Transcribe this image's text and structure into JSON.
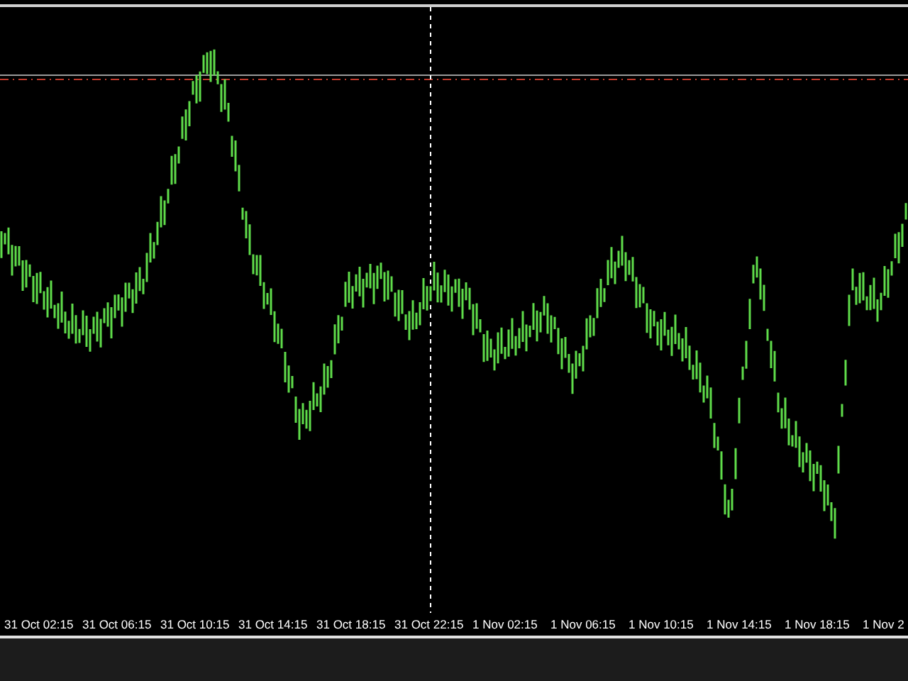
{
  "time_axis": {
    "labels": [
      "31 Oct 02:15",
      "31 Oct 06:15",
      "31 Oct 10:15",
      "31 Oct 14:15",
      "31 Oct 18:15",
      "31 Oct 22:15",
      "1 Nov 02:15",
      "1 Nov 06:15",
      "1 Nov 10:15",
      "1 Nov 14:15",
      "1 Nov 18:15",
      "1 Nov 2"
    ]
  }
}
